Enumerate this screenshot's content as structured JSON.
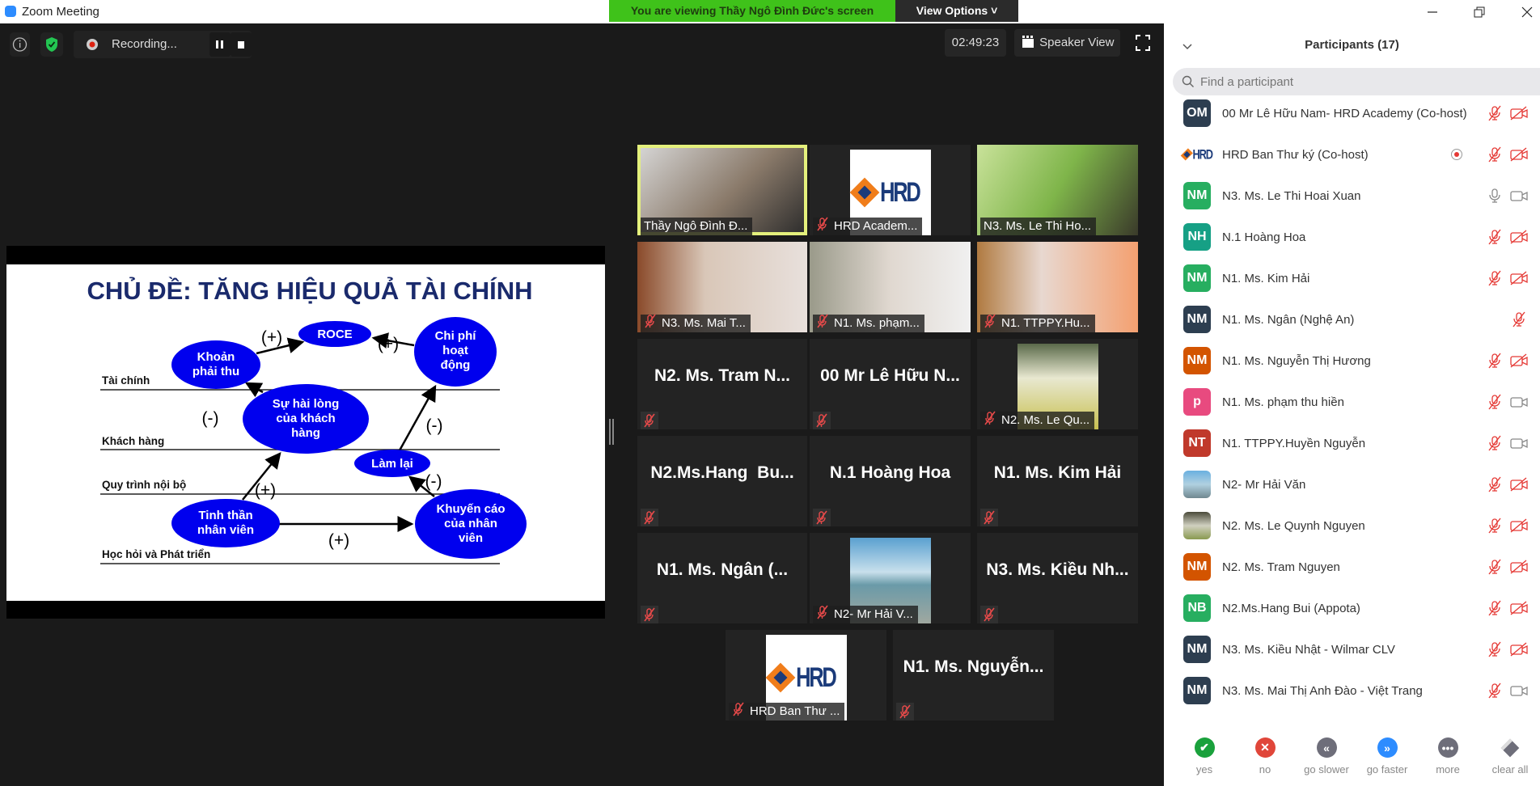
{
  "window": {
    "title": "Zoom Meeting"
  },
  "banner": {
    "text": "You are viewing Thầy Ngô Đình Đức's screen",
    "view_options": "View Options ˅"
  },
  "toolbar": {
    "recording": "Recording...",
    "timer": "02:49:23",
    "speaker_view": "Speaker View"
  },
  "slide": {
    "title": "CHỦ ĐỀ: TĂNG HIỆU QUẢ TÀI CHÍNH",
    "rows": [
      "Tài chính",
      "Khách hàng",
      "Quy trình nội bộ",
      "Học hỏi và Phát triển"
    ],
    "nodes": {
      "roce": [
        "ROCE"
      ],
      "khoan": [
        "Khoản",
        "phải thu"
      ],
      "chiphi": [
        "Chi phí",
        "hoạt",
        "động"
      ],
      "hailong": [
        "Sự hài lòng",
        "của khách",
        "hàng"
      ],
      "lamlai": [
        "Làm lại"
      ],
      "tinhthan": [
        "Tinh thần",
        "nhân viên"
      ],
      "khuyencao": [
        "Khuyến cáo",
        "của nhân",
        "viên"
      ]
    },
    "signs": [
      "(+)",
      "(+)",
      "(-)",
      "(-)",
      "(+)",
      "(-)",
      "(+)"
    ]
  },
  "tiles": [
    {
      "kind": "video",
      "label": "Thầy Ngô Đình Đ...",
      "muted": false,
      "active": true,
      "bg": "linear-gradient(135deg,#d8d8d8,#8a7a6a 55%,#2a2a2a)"
    },
    {
      "kind": "logo",
      "label": "HRD Academ...",
      "muted": true
    },
    {
      "kind": "video",
      "label": "N3. Ms. Le Thi Ho...",
      "muted": false,
      "bg": "linear-gradient(120deg,#c9e29a,#7fb54a 50%,#3a3a2a)"
    },
    {
      "kind": "video",
      "label": "N3. Ms. Mai T...",
      "muted": true,
      "bg": "linear-gradient(90deg,#8a4a2a,#d9c7b8 40%,#e8e0dc)"
    },
    {
      "kind": "video",
      "label": "N1. Ms. phạm...",
      "muted": true,
      "bg": "linear-gradient(90deg,#9a9a8a,#e0d8d0 50%,#f0f0f0)"
    },
    {
      "kind": "video",
      "label": "N1. TTPPY.Hu...",
      "muted": true,
      "bg": "linear-gradient(90deg,#b07a40,#e8d8d0 40%,#f4a070)"
    },
    {
      "kind": "name",
      "name": "N2. Ms. Tram N...",
      "muted": true
    },
    {
      "kind": "name",
      "name": "00 Mr Lê Hữu N...",
      "muted": true
    },
    {
      "kind": "photo",
      "label": "N2. Ms. Le Qu...",
      "muted": true,
      "bg": "linear-gradient(180deg,#5a6a4a,#e8e8d0 40%,#c8c050)"
    },
    {
      "kind": "name",
      "name": "N2.Ms.Hang  Bu...",
      "muted": true
    },
    {
      "kind": "name",
      "name": "N.1 Hoàng Hoa",
      "muted": true
    },
    {
      "kind": "name",
      "name": "N1. Ms. Kim Hải",
      "muted": true
    },
    {
      "kind": "name",
      "name": "N1. Ms. Ngân (...",
      "muted": true
    },
    {
      "kind": "photo",
      "label": "N2- Mr Hải V...",
      "muted": true,
      "bg": "linear-gradient(180deg,#5aa0d0,#c8e0ec 40%,#6a9aa8 55%,#a0a8a0)"
    },
    {
      "kind": "name",
      "name": "N3. Ms. Kiều Nh...",
      "muted": true
    },
    {
      "kind": "logo",
      "label": "HRD Ban Thư ...",
      "muted": true
    },
    {
      "kind": "name",
      "name": "N1. Ms. Nguyễn...",
      "muted": true
    }
  ],
  "participants": {
    "title": "Participants (17)",
    "search_placeholder": "Find a participant",
    "list": [
      {
        "initials": "OM",
        "color": "#2d3e50",
        "name": "00 Mr Lê Hữu Nam- HRD Academy (Co-host)",
        "mic": "muted",
        "cam": "off"
      },
      {
        "initials": "HRD",
        "color": "logo",
        "name": "HRD Ban Thư ký (Co-host)",
        "mic": "muted",
        "cam": "off",
        "recording": true
      },
      {
        "initials": "NM",
        "color": "#27ae60",
        "name": "N3. Ms. Le Thi Hoai Xuan",
        "mic": "on",
        "cam": "on"
      },
      {
        "initials": "NH",
        "color": "#16a085",
        "name": "N.1 Hoàng Hoa",
        "mic": "muted",
        "cam": "off"
      },
      {
        "initials": "NM",
        "color": "#27ae60",
        "name": "N1. Ms. Kim Hải",
        "mic": "muted",
        "cam": "off"
      },
      {
        "initials": "NM",
        "color": "#2d3e50",
        "name": "N1. Ms. Ngân (Nghệ An)",
        "mic": "none",
        "cam": "mutedmic"
      },
      {
        "initials": "NM",
        "color": "#d35400",
        "name": "N1. Ms. Nguyễn Thị Hương",
        "mic": "muted",
        "cam": "off"
      },
      {
        "initials": "p",
        "color": "#e84a7f",
        "name": "N1. Ms. phạm thu hiền",
        "mic": "muted",
        "cam": "on"
      },
      {
        "initials": "NT",
        "color": "#c0392b",
        "name": "N1. TTPPY.Huyền Nguyễn",
        "mic": "muted",
        "cam": "on"
      },
      {
        "initials": "",
        "color": "linear-gradient(180deg,#6ab0e0,#b0d0e0 50%,#708890)",
        "name": "N2- Mr Hải Văn",
        "mic": "muted",
        "cam": "off"
      },
      {
        "initials": "",
        "color": "linear-gradient(180deg,#4a4a3a,#d0d0c0 50%,#8a9a50)",
        "name": "N2. Ms. Le Quynh Nguyen",
        "mic": "muted",
        "cam": "off"
      },
      {
        "initials": "NM",
        "color": "#d35400",
        "name": "N2. Ms. Tram Nguyen",
        "mic": "muted",
        "cam": "off"
      },
      {
        "initials": "NB",
        "color": "#27ae60",
        "name": "N2.Ms.Hang Bui (Appota)",
        "mic": "muted",
        "cam": "off"
      },
      {
        "initials": "NM",
        "color": "#2d3e50",
        "name": "N3. Ms. Kiều Nhật - Wilmar CLV",
        "mic": "muted",
        "cam": "off"
      },
      {
        "initials": "NM",
        "color": "#2d3e50",
        "name": "N3. Ms. Mai Thị Anh Đào - Việt Trang",
        "mic": "muted",
        "cam": "on"
      }
    ],
    "feedback": [
      {
        "label": "yes",
        "glyph": "✔",
        "color": "#1aa13c"
      },
      {
        "label": "no",
        "glyph": "✕",
        "color": "#e0463a"
      },
      {
        "label": "go slower",
        "glyph": "«",
        "color": "#6e6e7a"
      },
      {
        "label": "go faster",
        "glyph": "»",
        "color": "#2d8cff"
      },
      {
        "label": "more",
        "glyph": "•••",
        "color": "#6e6e7a"
      },
      {
        "label": "clear all",
        "glyph": "",
        "color": "#6e6e7a"
      }
    ]
  }
}
